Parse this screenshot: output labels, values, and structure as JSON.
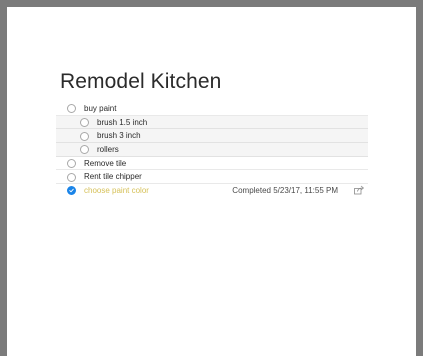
{
  "list": {
    "title": "Remodel Kitchen",
    "items": [
      {
        "label": "buy paint"
      },
      {
        "label": "brush 1.5 inch"
      },
      {
        "label": "brush 3 inch"
      },
      {
        "label": "rollers"
      },
      {
        "label": "Remove tile"
      },
      {
        "label": "Rent tile chipper"
      },
      {
        "label": "choose paint color",
        "completed": "Completed 5/23/17, 11:55 PM"
      }
    ]
  },
  "colors": {
    "completed_text": "#d6c159",
    "checkbox_done": "#1a84e8"
  }
}
